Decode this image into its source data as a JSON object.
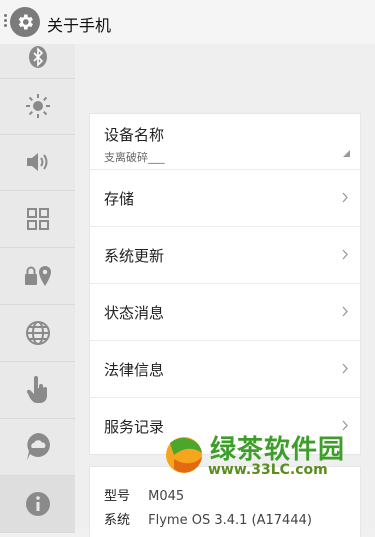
{
  "header": {
    "title": "关于手机",
    "settings_icon": "gear-icon"
  },
  "sidebar": {
    "items": [
      {
        "icon": "bluetooth-icon"
      },
      {
        "icon": "brightness-icon"
      },
      {
        "icon": "volume-icon"
      },
      {
        "icon": "apps-grid-icon"
      },
      {
        "icon": "location-lock-icon"
      },
      {
        "icon": "globe-icon"
      },
      {
        "icon": "gesture-hand-icon"
      },
      {
        "icon": "cloud-icon"
      },
      {
        "icon": "info-icon",
        "active": true
      }
    ]
  },
  "main": {
    "device": {
      "label": "设备名称",
      "value": "支离破碎___"
    },
    "rows": [
      {
        "label": "存储"
      },
      {
        "label": "系统更新"
      },
      {
        "label": "状态消息"
      },
      {
        "label": "法律信息"
      },
      {
        "label": "服务记录"
      }
    ],
    "specs": [
      {
        "key": "型号",
        "value": "M045"
      },
      {
        "key": "系统",
        "value": "Flyme OS 3.4.1 (A17444)"
      }
    ]
  },
  "watermark": {
    "title": "绿茶软件园",
    "url": "www.33LC.com"
  }
}
